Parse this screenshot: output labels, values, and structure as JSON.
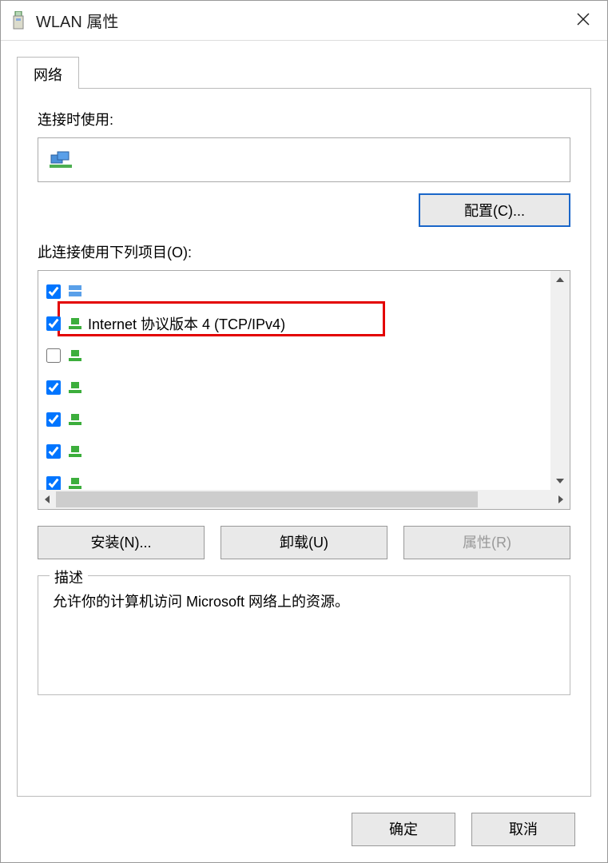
{
  "title": "WLAN 属性",
  "tab": "网络",
  "connect_using_label": "连接时使用:",
  "configure_btn": "配置(C)...",
  "items_label": "此连接使用下列项目(O):",
  "items": [
    {
      "checked": true,
      "icon": "other",
      "label": ""
    },
    {
      "checked": true,
      "icon": "green",
      "label": "Internet 协议版本 4 (TCP/IPv4)"
    },
    {
      "checked": false,
      "icon": "green",
      "label": ""
    },
    {
      "checked": true,
      "icon": "green",
      "label": ""
    },
    {
      "checked": true,
      "icon": "green",
      "label": ""
    },
    {
      "checked": true,
      "icon": "green",
      "label": ""
    },
    {
      "checked": true,
      "icon": "green",
      "label": ""
    }
  ],
  "install_btn": "安装(N)...",
  "uninstall_btn": "卸载(U)",
  "properties_btn": "属性(R)",
  "desc_legend": "描述",
  "desc_text": "允许你的计算机访问 Microsoft 网络上的资源。",
  "ok_btn": "确定",
  "cancel_btn": "取消"
}
